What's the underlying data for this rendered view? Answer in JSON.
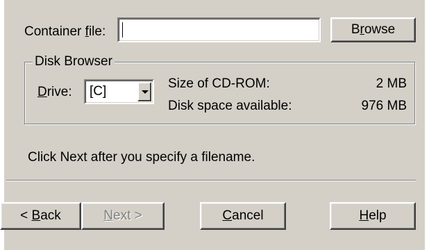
{
  "container": {
    "label_prefix": "Container ",
    "label_mnemonic": "f",
    "label_suffix": "ile:",
    "value": "",
    "browse_prefix": "B",
    "browse_mnemonic": "r",
    "browse_suffix": "owse"
  },
  "disk_browser": {
    "title": "Disk Browser",
    "drive_mnemonic": "D",
    "drive_suffix": "rive:",
    "drive_value": "[C]",
    "size_label": "Size of CD-ROM:",
    "size_value": "2 MB",
    "space_label": "Disk space available:",
    "space_value": "976 MB"
  },
  "instructions": "Click Next after you specify a filename.",
  "buttons": {
    "back_prefix": "< ",
    "back_mnemonic": "B",
    "back_suffix": "ack",
    "next_mnemonic": "N",
    "next_suffix": "ext >",
    "cancel_mnemonic": "C",
    "cancel_suffix": "ancel",
    "help_mnemonic": "H",
    "help_suffix": "elp"
  }
}
